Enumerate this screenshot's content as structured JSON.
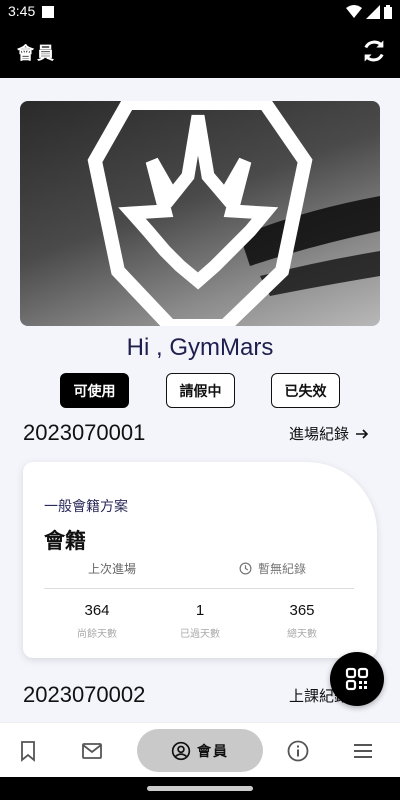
{
  "status_bar": {
    "time": "3:45"
  },
  "app_bar": {
    "title": "會員"
  },
  "profile": {
    "greeting": "Hi , GymMars",
    "filters": [
      "可使用",
      "請假中",
      "已失效"
    ]
  },
  "memberships": [
    {
      "id": "2023070001",
      "link_label": "進場紀錄",
      "card": {
        "plan_label": "一般會籍方案",
        "plan_name": "會籍",
        "last_entry_label": "上次進場",
        "last_entry_value": "暫無紀錄",
        "stats": [
          {
            "value": "364",
            "label": "尚餘天數"
          },
          {
            "value": "1",
            "label": "已過天數"
          },
          {
            "value": "365",
            "label": "總天數"
          }
        ]
      }
    },
    {
      "id": "2023070002",
      "link_label": "上課紀錄"
    }
  ],
  "bottom_nav": {
    "active_label": "會員"
  },
  "colors": {
    "accent": "#000000",
    "pill": "#c9c9c9",
    "greeting": "#1f1f4d"
  }
}
